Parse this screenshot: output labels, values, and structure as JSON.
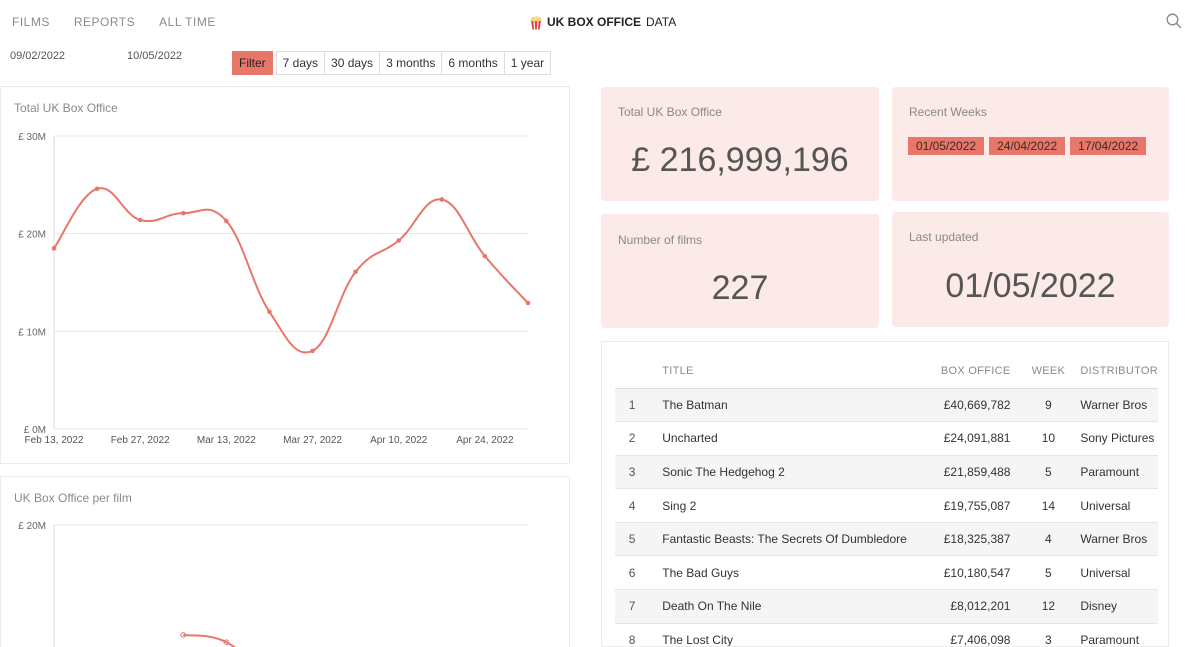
{
  "nav": {
    "items": [
      "FILMS",
      "REPORTS",
      "ALL TIME"
    ]
  },
  "brand": {
    "bold": "UK BOX OFFICE",
    "light": "DATA"
  },
  "filter": {
    "start_date": "09/02/2022",
    "end_date": "10/05/2022",
    "filter_label": "Filter",
    "ranges": [
      "7 days",
      "30 days",
      "3 months",
      "6 months",
      "1 year"
    ]
  },
  "stats": {
    "total_label": "Total UK Box Office",
    "total_value": "£ 216,999,196",
    "recent_label": "Recent Weeks",
    "recent_weeks": [
      "01/05/2022",
      "24/04/2022",
      "17/04/2022"
    ],
    "films_label": "Number of films",
    "films_value": "227",
    "updated_label": "Last updated",
    "updated_value": "01/05/2022"
  },
  "colors": {
    "accent": "#e8776a",
    "card": "#fbeae7"
  },
  "table": {
    "headers": {
      "title": "TITLE",
      "box": "BOX OFFICE",
      "week": "WEEK",
      "dist": "DISTRIBUTOR"
    },
    "rows": [
      {
        "rank": "1",
        "title": "The Batman",
        "box": "£40,669,782",
        "week": "9",
        "dist": "Warner Bros"
      },
      {
        "rank": "2",
        "title": "Uncharted",
        "box": "£24,091,881",
        "week": "10",
        "dist": "Sony Pictures"
      },
      {
        "rank": "3",
        "title": "Sonic The Hedgehog 2",
        "box": "£21,859,488",
        "week": "5",
        "dist": "Paramount"
      },
      {
        "rank": "4",
        "title": "Sing 2",
        "box": "£19,755,087",
        "week": "14",
        "dist": "Universal"
      },
      {
        "rank": "5",
        "title": "Fantastic Beasts: The Secrets Of Dumbledore",
        "box": "£18,325,387",
        "week": "4",
        "dist": "Warner Bros"
      },
      {
        "rank": "6",
        "title": "The Bad Guys",
        "box": "£10,180,547",
        "week": "5",
        "dist": "Universal"
      },
      {
        "rank": "7",
        "title": "Death On The Nile",
        "box": "£8,012,201",
        "week": "12",
        "dist": "Disney"
      },
      {
        "rank": "8",
        "title": "The Lost City",
        "box": "£7,406,098",
        "week": "3",
        "dist": "Paramount"
      }
    ]
  },
  "chart_data": [
    {
      "type": "line",
      "title": "Total UK Box Office",
      "x": [
        "2022-02-13",
        "2022-02-20",
        "2022-02-27",
        "2022-03-06",
        "2022-03-13",
        "2022-03-20",
        "2022-03-27",
        "2022-04-03",
        "2022-04-10",
        "2022-04-17",
        "2022-04-24",
        "2022-05-01"
      ],
      "values": [
        18.5,
        24.6,
        21.4,
        22.1,
        21.3,
        12.0,
        8.0,
        16.1,
        19.3,
        23.5,
        17.7,
        12.9
      ],
      "xticks": [
        "Feb 13, 2022",
        "Feb 27, 2022",
        "Mar 13, 2022",
        "Mar 27, 2022",
        "Apr 10, 2022",
        "Apr 24, 2022"
      ],
      "yticks": [
        "£ 0M",
        "£ 10M",
        "£ 20M",
        "£ 30M"
      ],
      "ylim": [
        0,
        30
      ],
      "color": "#e8776a",
      "grid": true
    },
    {
      "type": "line",
      "title": "UK Box Office per film",
      "x": [
        "2022-03-06",
        "2022-03-13",
        "2022-03-20"
      ],
      "values": [
        12.5,
        12.0,
        9.5
      ],
      "yticks": [
        "£ 20M"
      ],
      "ylim": [
        0,
        20
      ],
      "color": "#e8776a",
      "grid": true
    }
  ]
}
